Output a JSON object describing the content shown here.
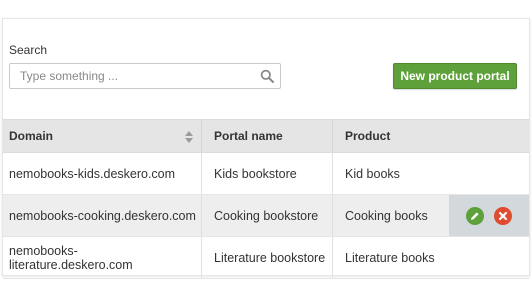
{
  "search": {
    "label": "Search",
    "placeholder": "Type something ..."
  },
  "toolbar": {
    "new_label": "New product portal"
  },
  "table": {
    "columns": [
      "Domain",
      "Portal name",
      "Product"
    ],
    "sorted_column": "Domain",
    "rows": [
      {
        "domain": "nemobooks-kids.deskero.com",
        "portal": "Kids bookstore",
        "product": "Kid books"
      },
      {
        "domain": "nemobooks-cooking.deskero.com",
        "portal": "Cooking bookstore",
        "product": "Cooking books"
      },
      {
        "domain": "nemobooks-literature.deskero.com",
        "portal": "Literature bookstore",
        "product": "Literature books"
      }
    ],
    "hovered_row": 1
  },
  "colors": {
    "accent_green": "#5ea13b",
    "delete_red": "#e04a2f",
    "header_gray": "#e5e5e5",
    "hover_row": "#eeeeee",
    "actions_bg": "#d3d8dc"
  },
  "icons": {
    "search": "search-icon",
    "sort": "sort-icon",
    "edit": "pencil-icon",
    "delete": "close-icon"
  }
}
